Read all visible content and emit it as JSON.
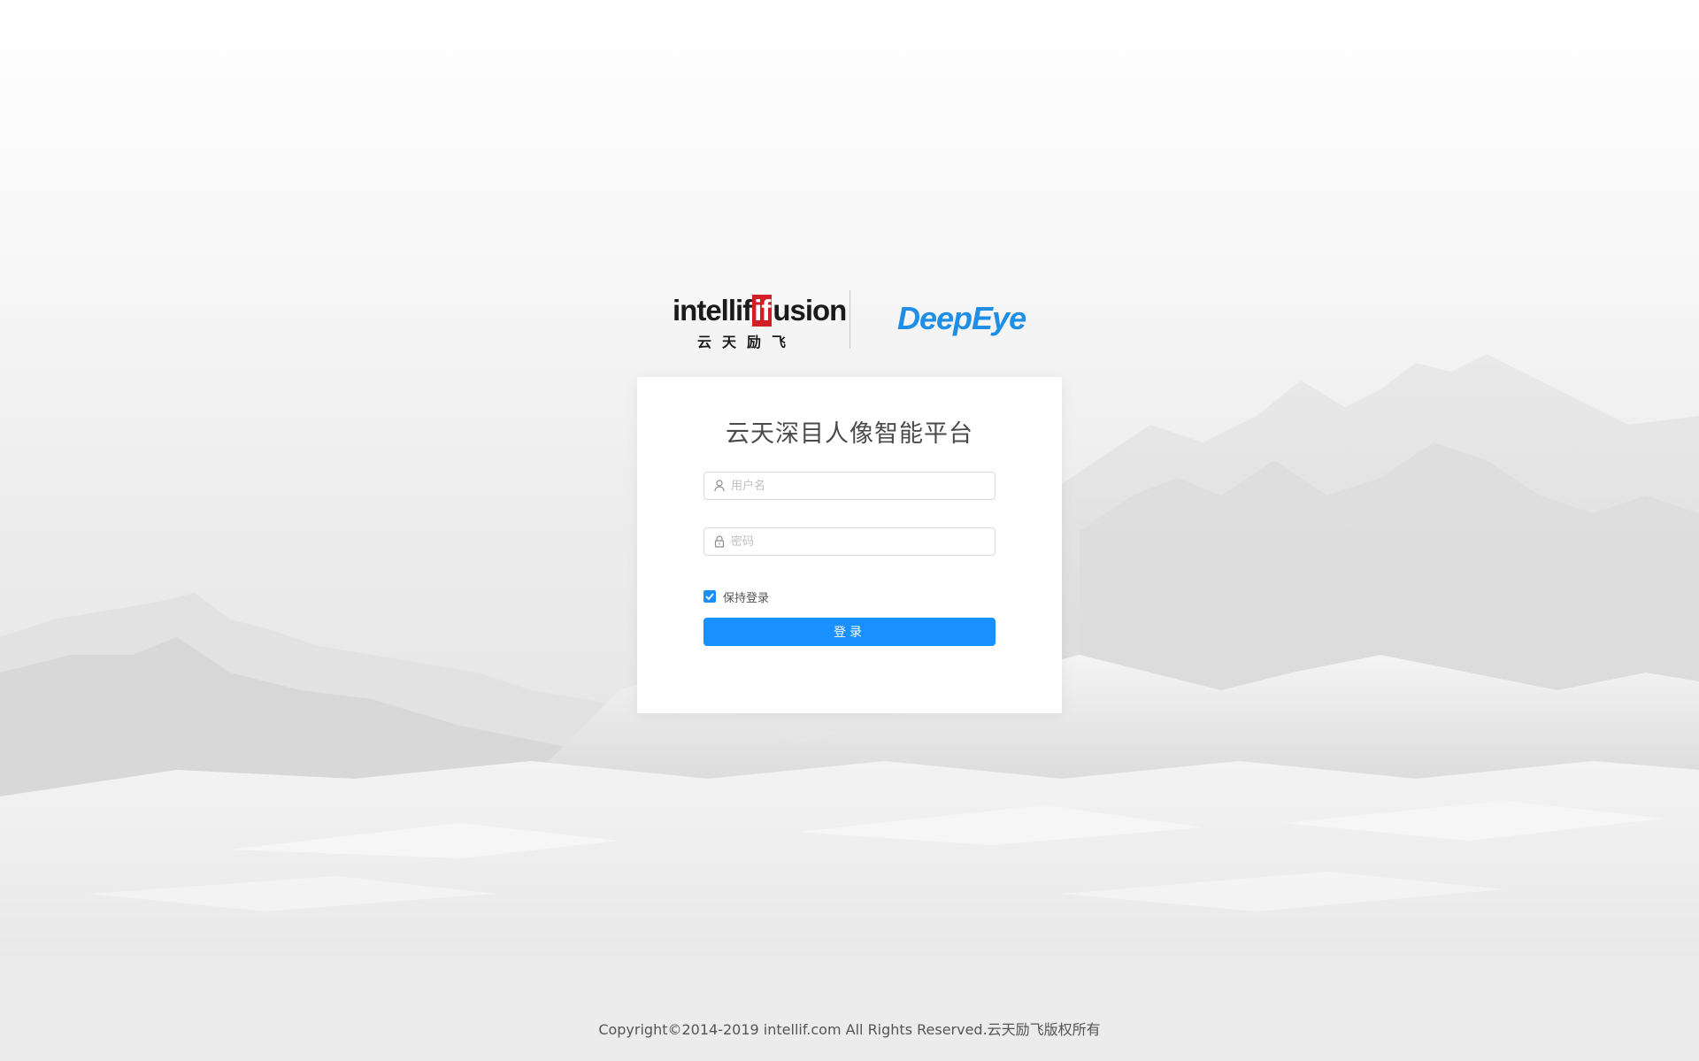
{
  "header": {
    "company_logo_text": "intellif",
    "company_logo_mark": "if",
    "company_logo_suffix": "usion",
    "company_logo_cn": "云天励飞",
    "product_logo": "DeepEye"
  },
  "login": {
    "title": "云天深目人像智能平台",
    "username_placeholder": "用户名",
    "password_placeholder": "密码",
    "remember_label": "保持登录",
    "remember_checked": true,
    "submit_label": "登录"
  },
  "footer": {
    "copyright": "Copyright©2014-2019 intellif.com All Rights Reserved.云天励飞版权所有"
  },
  "colors": {
    "accent": "#1890ff",
    "brand_red": "#d21f26",
    "deepeye_blue": "#1e8ee6"
  },
  "icons": {
    "username": "user-icon",
    "password": "lock-icon",
    "checkbox": "check-icon"
  }
}
